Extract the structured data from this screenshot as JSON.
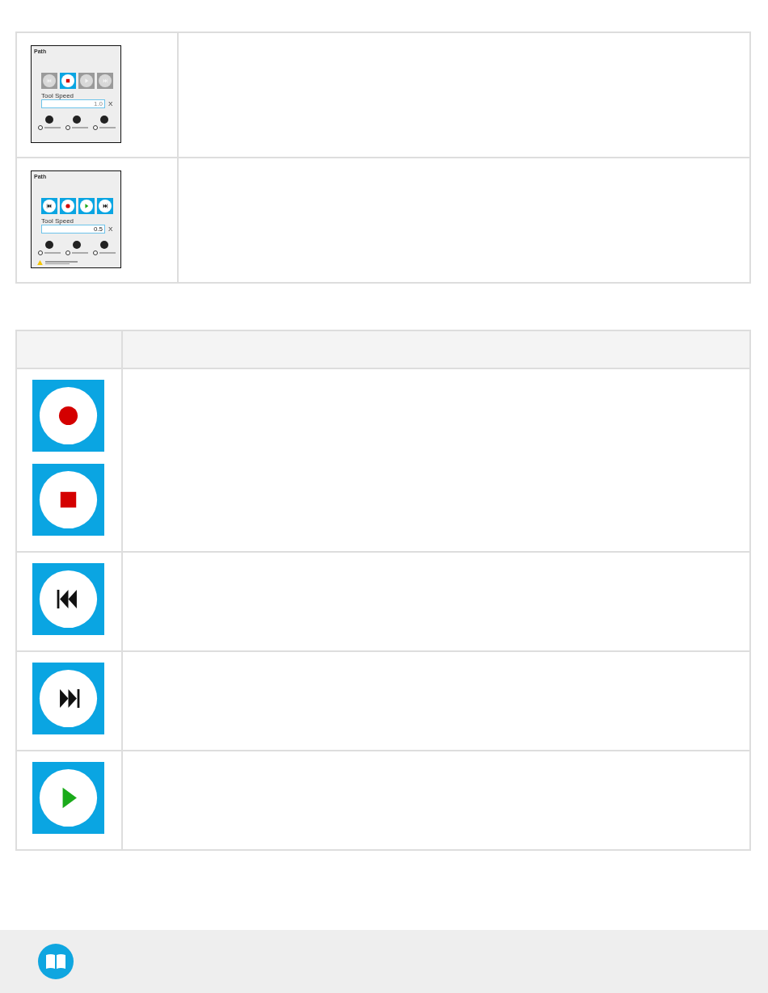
{
  "table_1": {
    "rows": [
      {
        "panel": {
          "title": "Path",
          "buttons": [
            {
              "kind": "rewind",
              "disabled": true
            },
            {
              "kind": "stop",
              "disabled": false
            },
            {
              "kind": "play",
              "disabled": true
            },
            {
              "kind": "forward",
              "disabled": true
            }
          ],
          "speed_label": "Tool Speed",
          "speed_value": "1.0",
          "speed_disabled": true,
          "speed_unit": "X",
          "options": [
            {
              "selected": false
            },
            {
              "selected": false
            },
            {
              "selected": false
            }
          ],
          "warning": false
        }
      },
      {
        "panel": {
          "title": "Path",
          "buttons": [
            {
              "kind": "rewind",
              "disabled": false
            },
            {
              "kind": "record",
              "disabled": false
            },
            {
              "kind": "play",
              "disabled": false
            },
            {
              "kind": "forward",
              "disabled": false
            }
          ],
          "speed_label": "Tool Speed",
          "speed_value": "0.5",
          "speed_disabled": false,
          "speed_unit": "X",
          "options": [
            {
              "selected": false
            },
            {
              "selected": false
            },
            {
              "selected": false
            }
          ],
          "warning": true
        }
      }
    ]
  },
  "table_2": {
    "rows": [
      {
        "icons": [
          {
            "kind": "record"
          },
          {
            "kind": "stop"
          }
        ]
      },
      {
        "icons": [
          {
            "kind": "rewind"
          }
        ]
      },
      {
        "icons": [
          {
            "kind": "forward"
          }
        ]
      },
      {
        "icons": [
          {
            "kind": "play"
          }
        ]
      }
    ]
  }
}
